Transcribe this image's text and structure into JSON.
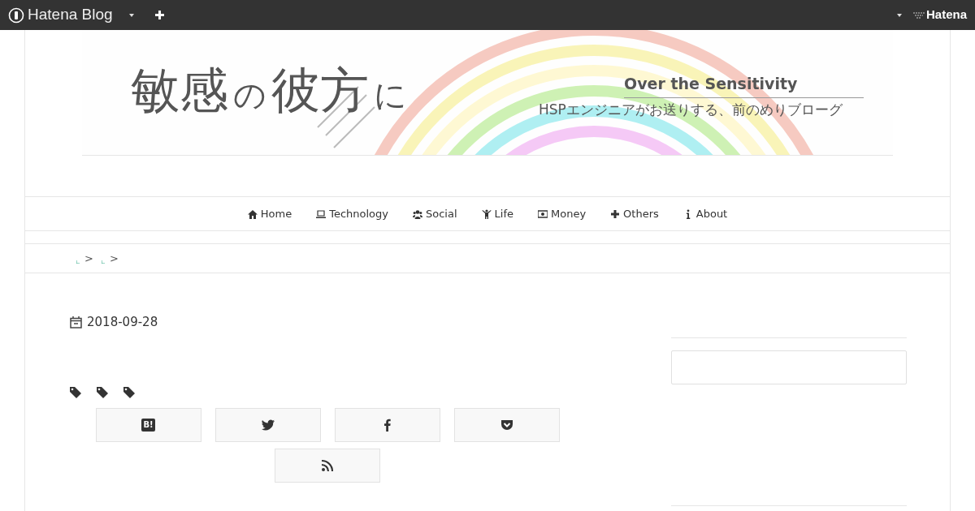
{
  "topbar": {
    "brand": "Hatena Blog",
    "right_brand": "Hatena"
  },
  "banner": {
    "title_parts": [
      "敏感",
      "の",
      "彼方",
      "に"
    ],
    "subtitle": "Over the Sensitivity",
    "tagline": "HSPエンジニアがお送りする、前のめりブローグ"
  },
  "nav": [
    "Home",
    "Technology",
    "Social",
    "Life",
    "Money",
    "Others",
    "About"
  ],
  "breadcrumb": {
    "separators": [
      ">",
      ">"
    ]
  },
  "post": {
    "date": "2018-09-28"
  },
  "share": [
    {
      "kind": "hatena",
      "label": "B!"
    },
    {
      "kind": "twitter"
    },
    {
      "kind": "facebook"
    },
    {
      "kind": "pocket"
    },
    {
      "kind": "rss"
    }
  ]
}
